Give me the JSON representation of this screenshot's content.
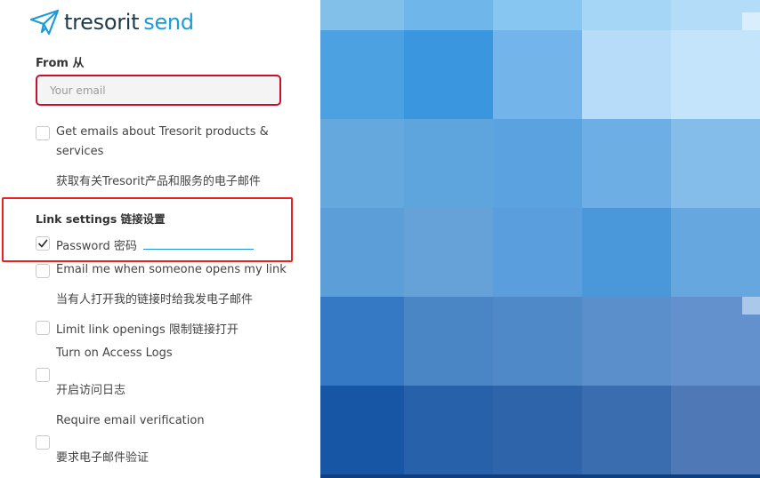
{
  "app": {
    "brand": "tresorit",
    "product": "send"
  },
  "from": {
    "label": "From 从",
    "email_placeholder": "Your email",
    "email_value": ""
  },
  "options": {
    "marketing_en": "Get emails about Tresorit products &",
    "marketing_en_2": "services",
    "marketing_zh": "获取有关Tresorit产品和服务的电子邮件"
  },
  "link_settings": {
    "label": "Link settings 链接设置",
    "password_label": "Password 密码",
    "password_checked": true,
    "notify_en": "Email me when someone opens my link",
    "notify_zh": "当有人打开我的链接时给我发电子邮件",
    "limit_label": "Limit link openings 限制链接打开",
    "access_logs_en": "Turn on Access Logs",
    "access_logs_zh": "开启访问日志",
    "verify_en": "Require email verification",
    "verify_zh": "要求电子邮件验证"
  },
  "colors": {
    "accent": "#1d9bd8",
    "error_border": "#c8102e",
    "annotation_red": "#e8221e",
    "brand_dark": "#1f3a4d"
  },
  "icons": {
    "logo": "paper-plane-icon",
    "check": "checkmark-icon"
  }
}
